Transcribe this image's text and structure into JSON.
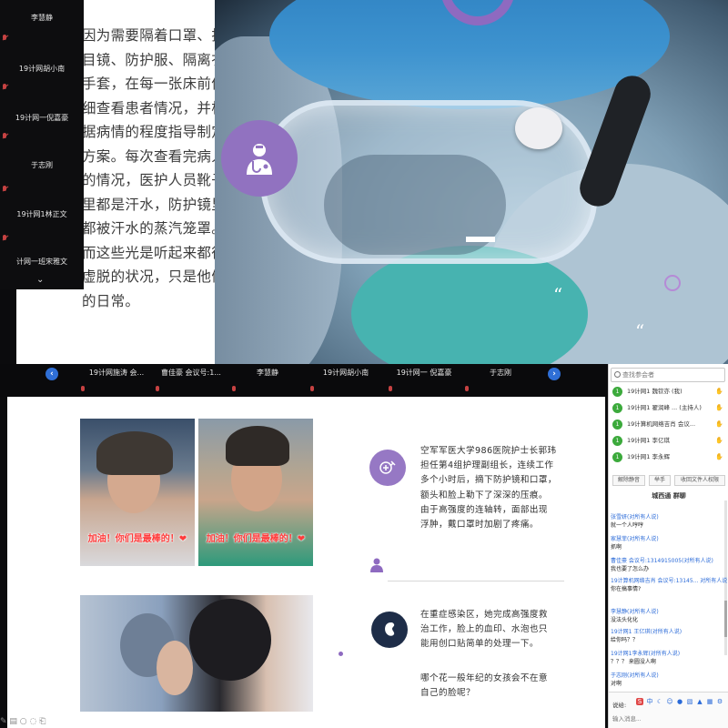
{
  "top_slide": {
    "lines": [
      "因为需要隔着口罩、护",
      "目镜、防护服、隔离衣、",
      "手套，在每一张床前仔",
      "细查看患者情况，并根",
      "据病情的程度指导制定",
      "方案。每次查看完病人",
      "的情况，医护人员靴子",
      "里都是汗水，防护镜里",
      "都被汗水的蒸汽笼罩。",
      "而这些光是听起来都很",
      "虚脱的状况，只是他们",
      "的日常。"
    ],
    "quote_glyph": "“"
  },
  "left_participants": [
    {
      "name": "李慧静"
    },
    {
      "name": "19计网胡小南"
    },
    {
      "name": "19计网一倪嘉豪"
    },
    {
      "name": "于志刚"
    },
    {
      "name": "19计网1林正文"
    },
    {
      "name": "计网一班宋雅文"
    }
  ],
  "strip": {
    "prev_label": "‹",
    "next_label": "›",
    "items": [
      {
        "name": "19计网施涛 会..."
      },
      {
        "name": "曹佳豪 会议号:1..."
      },
      {
        "name": "李慧静"
      },
      {
        "name": "19计网胡小南"
      },
      {
        "name": "19计网一 倪嘉豪"
      },
      {
        "name": "于志刚"
      }
    ]
  },
  "slide2": {
    "photo_caption": "加油！你们是最棒的！❤",
    "para1": [
      "空军军医大学986医院护士长郭玮",
      "担任第4组护理副组长，连续工作",
      "多个小时后，摘下防护镜和口罩，",
      "额头和脸上勒下了深深的压痕。",
      "由于高强度的连轴转，面部出现",
      "浮肿，戴口罩时加剧了疼痛。"
    ],
    "para2": [
      "在重症感染区，她完成高强度救",
      "治工作，脸上的血印、水泡也只",
      "能用创口贴简单的处理一下。"
    ],
    "para3": [
      "哪个花一般年纪的女孩会不在意",
      "自己的脸呢？"
    ],
    "bottom_tools": "✎ ▤ ○ ◌ ⎗"
  },
  "chat": {
    "search_placeholder": "查找参会者",
    "members": [
      {
        "name": "19计网1 魏钦亦 (我)",
        "badge": "1"
      },
      {
        "name": "19计网1 翟润峰 ... (主持人)",
        "badge": "1"
      },
      {
        "name": "19计算机网络吉肖 会议...",
        "badge": "1"
      },
      {
        "name": "19计网1 李亿琪",
        "badge": "1"
      },
      {
        "name": "19计网1 李永辉",
        "badge": "1"
      },
      {
        "name": "19计网1 ...",
        "badge": "1"
      }
    ],
    "hand_label": "✋",
    "buttons": [
      "解除静音",
      "举手",
      "收回文件人权限"
    ],
    "title": "城西通 群聊",
    "messages": [
      {
        "head": "张雪妍(对所有人说)",
        "body": "就一个人哼哼"
      },
      {
        "head": "家慧菲(对所有人说)",
        "body": "抓啊"
      },
      {
        "head": "曹佳豪 会议号:1314915005(对所有人说)",
        "body": "我也要了怎么办"
      },
      {
        "head": "19计算机网络吉肖 会议号:13145... 对所有人说",
        "body": "你在搞事情?"
      },
      {
        "head": "李慧静(对所有人说)",
        "body": "没法头化化"
      },
      {
        "head": "19计网1 王亿琪(对所有人说)",
        "body": "给你吗？？"
      },
      {
        "head": "19计网1李永辉(对所有人说)",
        "body": "？？？ 来圆没人啊"
      },
      {
        "head": "于志刚(对所有人说)",
        "body": "对啊"
      }
    ],
    "input_label": "说给:",
    "input_placeholder": "输入消息..."
  }
}
